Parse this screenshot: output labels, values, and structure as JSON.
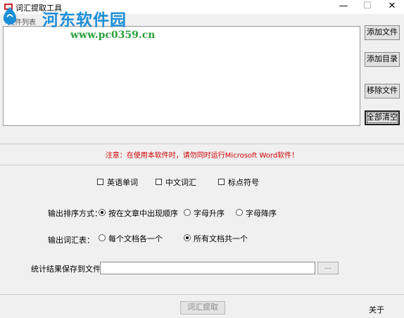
{
  "window": {
    "title": "词汇提取工具",
    "minimize": "—",
    "maximize": "☐",
    "close": "✕"
  },
  "watermark": {
    "name": "河东软件园",
    "url": "www.pc0359.cn"
  },
  "file_list": {
    "label": "文件列表"
  },
  "side_buttons": {
    "add_file": "添加文件",
    "add_folder": "添加目录",
    "remove_file": "移除文件",
    "clear_all": "全部清空"
  },
  "warning": "注意：在使用本软件时，请勿同时运行Microsoft Word软件！",
  "checkboxes": {
    "english_words": "英语单词",
    "chinese_words": "中文词汇",
    "punctuation": "标点符号"
  },
  "sort": {
    "label": "输出排序方式：",
    "opt_order": "按在文章中出现顺序",
    "opt_asc": "字母升序",
    "opt_desc": "字母降序",
    "selected": "opt_order"
  },
  "output_table": {
    "label": "输出词汇表：",
    "opt_each": "每个文档各一个",
    "opt_all": "所有文档共一个",
    "selected": "opt_all"
  },
  "save": {
    "label": "统计结果保存到文件：",
    "value": "",
    "browse": "..."
  },
  "footer": {
    "extract": "词汇提取",
    "close": "关于"
  },
  "colors": {
    "warning": "#d00000",
    "watermark_name": "#1a8fd8",
    "watermark_url": "#2aa13a"
  }
}
